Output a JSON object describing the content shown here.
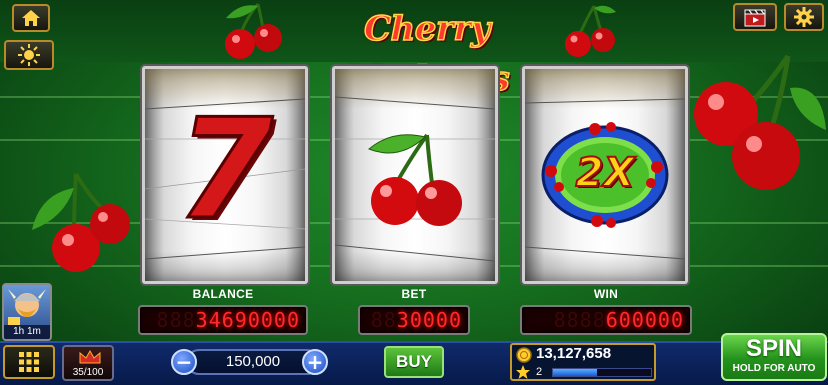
{
  "game": {
    "title": "Cherry Madness"
  },
  "top_left_buttons": [
    {
      "icon": "home-icon"
    },
    {
      "icon": "sun-icon"
    }
  ],
  "top_right_buttons": [
    {
      "icon": "video-clapper-icon"
    },
    {
      "icon": "gear-icon"
    }
  ],
  "reels": [
    {
      "symbol": "seven",
      "label": "7"
    },
    {
      "symbol": "cherries"
    },
    {
      "symbol": "multiplier",
      "label": "2X"
    }
  ],
  "meters": {
    "balance": {
      "label": "BALANCE",
      "ghost": "888",
      "value": "34690000"
    },
    "bet": {
      "label": "BET",
      "ghost": "88",
      "value": "30000"
    },
    "win": {
      "label": "WIN",
      "ghost": "8888",
      "value": "600000"
    }
  },
  "timer_badge": {
    "text": "1h 1m"
  },
  "bottom_bar": {
    "progress_text": "35/100",
    "progress_fraction": 0.35,
    "bet_amount": "150,000",
    "minus": "−",
    "plus": "+",
    "buy_label": "BUY",
    "coins": "13,127,658",
    "level": "2",
    "xp_fraction": 0.45,
    "spin_label": "SPIN",
    "spin_sub": "HOLD FOR AUTO"
  },
  "colors": {
    "title_fill": "#ff3a2a",
    "title_outline": "#ffd84a",
    "meter_digits": "#ff2a2a",
    "spin_green": "#3fae2c"
  }
}
